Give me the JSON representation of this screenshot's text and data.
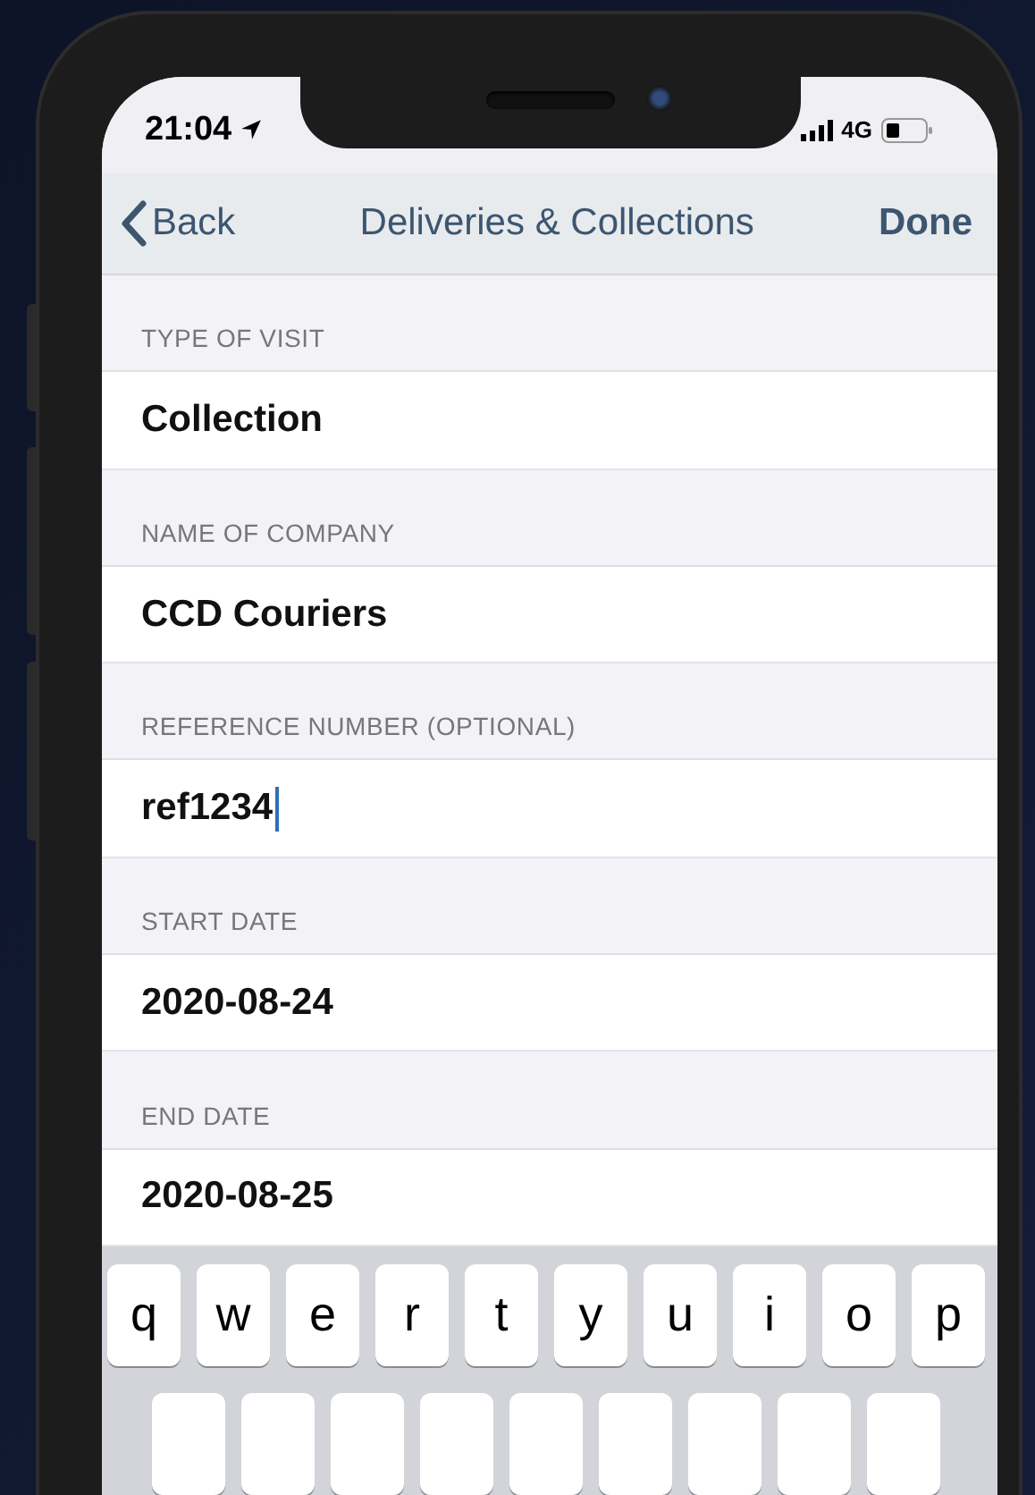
{
  "status_bar": {
    "time": "21:04",
    "network": "4G"
  },
  "nav_bar": {
    "back": "Back",
    "title": "Deliveries & Collections",
    "done": "Done"
  },
  "sections": [
    {
      "header": "TYPE OF VISIT",
      "value": "Collection",
      "focused": false
    },
    {
      "header": "NAME OF COMPANY",
      "value": "CCD Couriers",
      "focused": false
    },
    {
      "header": "REFERENCE NUMBER (OPTIONAL)",
      "value": "ref1234",
      "focused": true
    },
    {
      "header": "START DATE",
      "value": "2020-08-24",
      "focused": false
    },
    {
      "header": "END DATE",
      "value": "2020-08-25",
      "focused": false
    }
  ],
  "keyboard": {
    "row_1": [
      "q",
      "w",
      "e",
      "r",
      "t",
      "y",
      "u",
      "i",
      "o",
      "p"
    ]
  }
}
